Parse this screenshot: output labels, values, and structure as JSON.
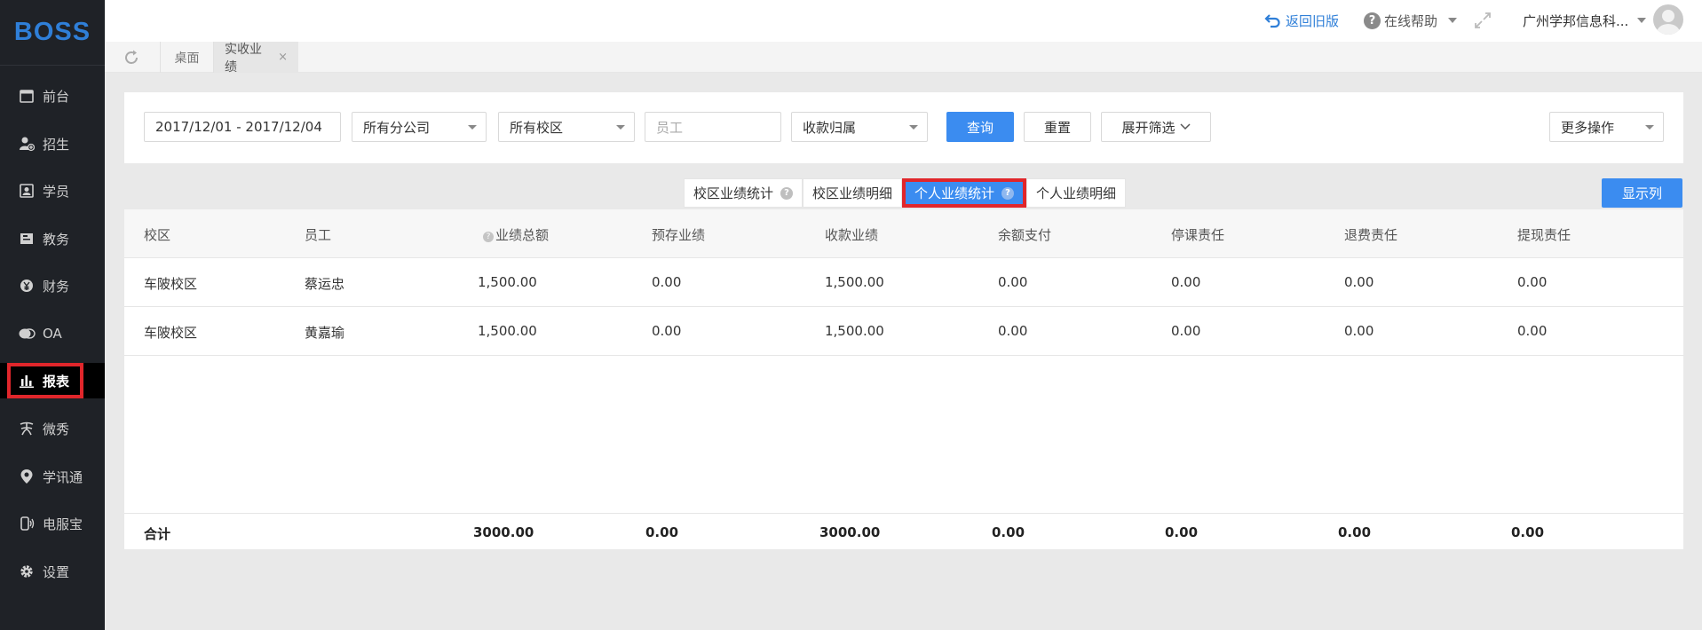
{
  "app": {
    "logo_text": "BOSS",
    "brand_color": "#2f7fd8",
    "accent_color": "#3b8cf0",
    "highlight_color": "#e0262b"
  },
  "sidebar": {
    "items": [
      {
        "label": "前台",
        "icon": "calendar-icon"
      },
      {
        "label": "招生",
        "icon": "add-user-icon"
      },
      {
        "label": "学员",
        "icon": "student-card-icon"
      },
      {
        "label": "教务",
        "icon": "book-icon"
      },
      {
        "label": "财务",
        "icon": "yen-coin-icon"
      },
      {
        "label": "OA",
        "icon": "chat-bubbles-icon"
      },
      {
        "label": "报表",
        "icon": "bar-chart-icon"
      },
      {
        "label": "微秀",
        "icon": "weixiu-icon"
      },
      {
        "label": "学讯通",
        "icon": "location-pin-icon"
      },
      {
        "label": "电服宝",
        "icon": "phone-signal-icon"
      },
      {
        "label": "设置",
        "icon": "gear-icon"
      }
    ],
    "active": "报表"
  },
  "header": {
    "back_old": "返回旧版",
    "help": "在线帮助",
    "company": "广州学邦信息科..."
  },
  "tabs": {
    "desk": "桌面",
    "current": "实收业绩",
    "close_glyph": "×"
  },
  "filters": {
    "date_range": "2017/12/01 - 2017/12/04",
    "branch": "所有分公司",
    "campus": "所有校区",
    "staff_placeholder": "员工",
    "belong": "收款归属",
    "query": "查询",
    "reset": "重置",
    "expand": "展开筛选",
    "more": "更多操作"
  },
  "subtabs": [
    {
      "label": "校区业绩统计",
      "help": true
    },
    {
      "label": "校区业绩明细",
      "help": false
    },
    {
      "label": "个人业绩统计",
      "help": true
    },
    {
      "label": "个人业绩明细",
      "help": false
    }
  ],
  "active_subtab": "个人业绩统计",
  "show_columns": "显示列",
  "table": {
    "columns": [
      "校区",
      "员工",
      "业绩总额",
      "预存业绩",
      "收款业绩",
      "余额支付",
      "停课责任",
      "退费责任",
      "提现责任"
    ],
    "rows": [
      [
        "车陂校区",
        "蔡运忠",
        "1,500.00",
        "0.00",
        "1,500.00",
        "0.00",
        "0.00",
        "0.00",
        "0.00"
      ],
      [
        "车陂校区",
        "黄嘉瑜",
        "1,500.00",
        "0.00",
        "1,500.00",
        "0.00",
        "0.00",
        "0.00",
        "0.00"
      ]
    ],
    "total": [
      "合计",
      "3000.00",
      "0.00",
      "3000.00",
      "0.00",
      "0.00",
      "0.00",
      "0.00"
    ]
  }
}
